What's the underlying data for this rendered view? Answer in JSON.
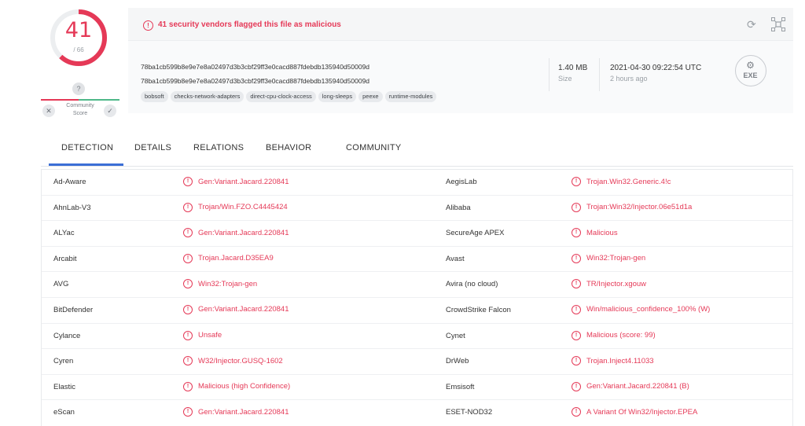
{
  "score": {
    "detected": "41",
    "total": "/ 66",
    "ring_fraction": 0.62,
    "accent": "#e53957"
  },
  "community": {
    "question": "?",
    "label_line1": "Community",
    "label_line2": "Score",
    "dislike": "✕",
    "like": "✓"
  },
  "alert": {
    "text": "41 security vendors flagged this file as malicious",
    "icon": "!"
  },
  "file": {
    "hash_1": "78ba1cb599b8e9e7e8a02497d3b3cbf29ff3e0cacd887fdebdb135940d50009d",
    "hash_2": "78ba1cb599b8e9e7e8a02497d3b3cbf29ff3e0cacd887fdebdb135940d50009d",
    "tags": [
      "bobsoft",
      "checks-network-adapters",
      "direct-cpu-clock-access",
      "long-sleeps",
      "peexe",
      "runtime-modules"
    ],
    "size_value": "1.40 MB",
    "size_label": "Size",
    "date_value": "2021-04-30 09:22:54 UTC",
    "date_label": "2 hours ago",
    "type_label": "EXE"
  },
  "tabs": [
    {
      "label": "DETECTION",
      "active": true
    },
    {
      "label": "DETAILS"
    },
    {
      "label": "RELATIONS"
    },
    {
      "label": "BEHAVIOR"
    },
    {
      "label": "COMMUNITY"
    }
  ],
  "detections": [
    {
      "engine_left": "Ad-Aware",
      "result_left": "Gen:Variant.Jacard.220841",
      "engine_right": "AegisLab",
      "result_right": "Trojan.Win32.Generic.4!c"
    },
    {
      "engine_left": "AhnLab-V3",
      "result_left": "Trojan/Win.FZO.C4445424",
      "engine_right": "Alibaba",
      "result_right": "Trojan:Win32/Injector.06e51d1a"
    },
    {
      "engine_left": "ALYac",
      "result_left": "Gen:Variant.Jacard.220841",
      "engine_right": "SecureAge APEX",
      "result_right": "Malicious"
    },
    {
      "engine_left": "Arcabit",
      "result_left": "Trojan.Jacard.D35EA9",
      "engine_right": "Avast",
      "result_right": "Win32:Trojan-gen"
    },
    {
      "engine_left": "AVG",
      "result_left": "Win32:Trojan-gen",
      "engine_right": "Avira (no cloud)",
      "result_right": "TR/Injector.xgouw"
    },
    {
      "engine_left": "BitDefender",
      "result_left": "Gen:Variant.Jacard.220841",
      "engine_right": "CrowdStrike Falcon",
      "result_right": "Win/malicious_confidence_100% (W)"
    },
    {
      "engine_left": "Cylance",
      "result_left": "Unsafe",
      "engine_right": "Cynet",
      "result_right": "Malicious (score: 99)"
    },
    {
      "engine_left": "Cyren",
      "result_left": "W32/Injector.GUSQ-1602",
      "engine_right": "DrWeb",
      "result_right": "Trojan.Inject4.11033"
    },
    {
      "engine_left": "Elastic",
      "result_left": "Malicious (high Confidence)",
      "engine_right": "Emsisoft",
      "result_right": "Gen:Variant.Jacard.220841 (B)"
    },
    {
      "engine_left": "eScan",
      "result_left": "Gen:Variant.Jacard.220841",
      "engine_right": "ESET-NOD32",
      "result_right": "A Variant Of Win32/Injector.EPEA"
    }
  ]
}
